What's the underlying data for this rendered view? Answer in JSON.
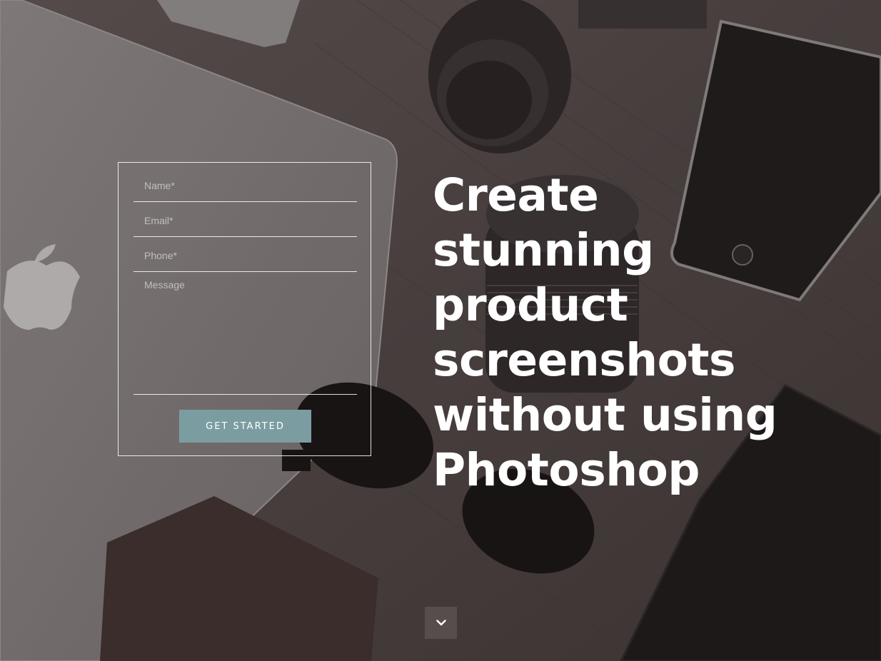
{
  "form": {
    "name_placeholder": "Name*",
    "email_placeholder": "Email*",
    "phone_placeholder": "Phone*",
    "message_placeholder": "Message",
    "submit_label": "GET STARTED",
    "button_color": "#7b9da1"
  },
  "hero": {
    "line1": "Create",
    "line2": "stunning",
    "line3": "product",
    "line4": "screenshots",
    "line5": "without using",
    "line6": "Photoshop"
  },
  "scroll_down": {
    "icon": "chevron-down-icon"
  }
}
